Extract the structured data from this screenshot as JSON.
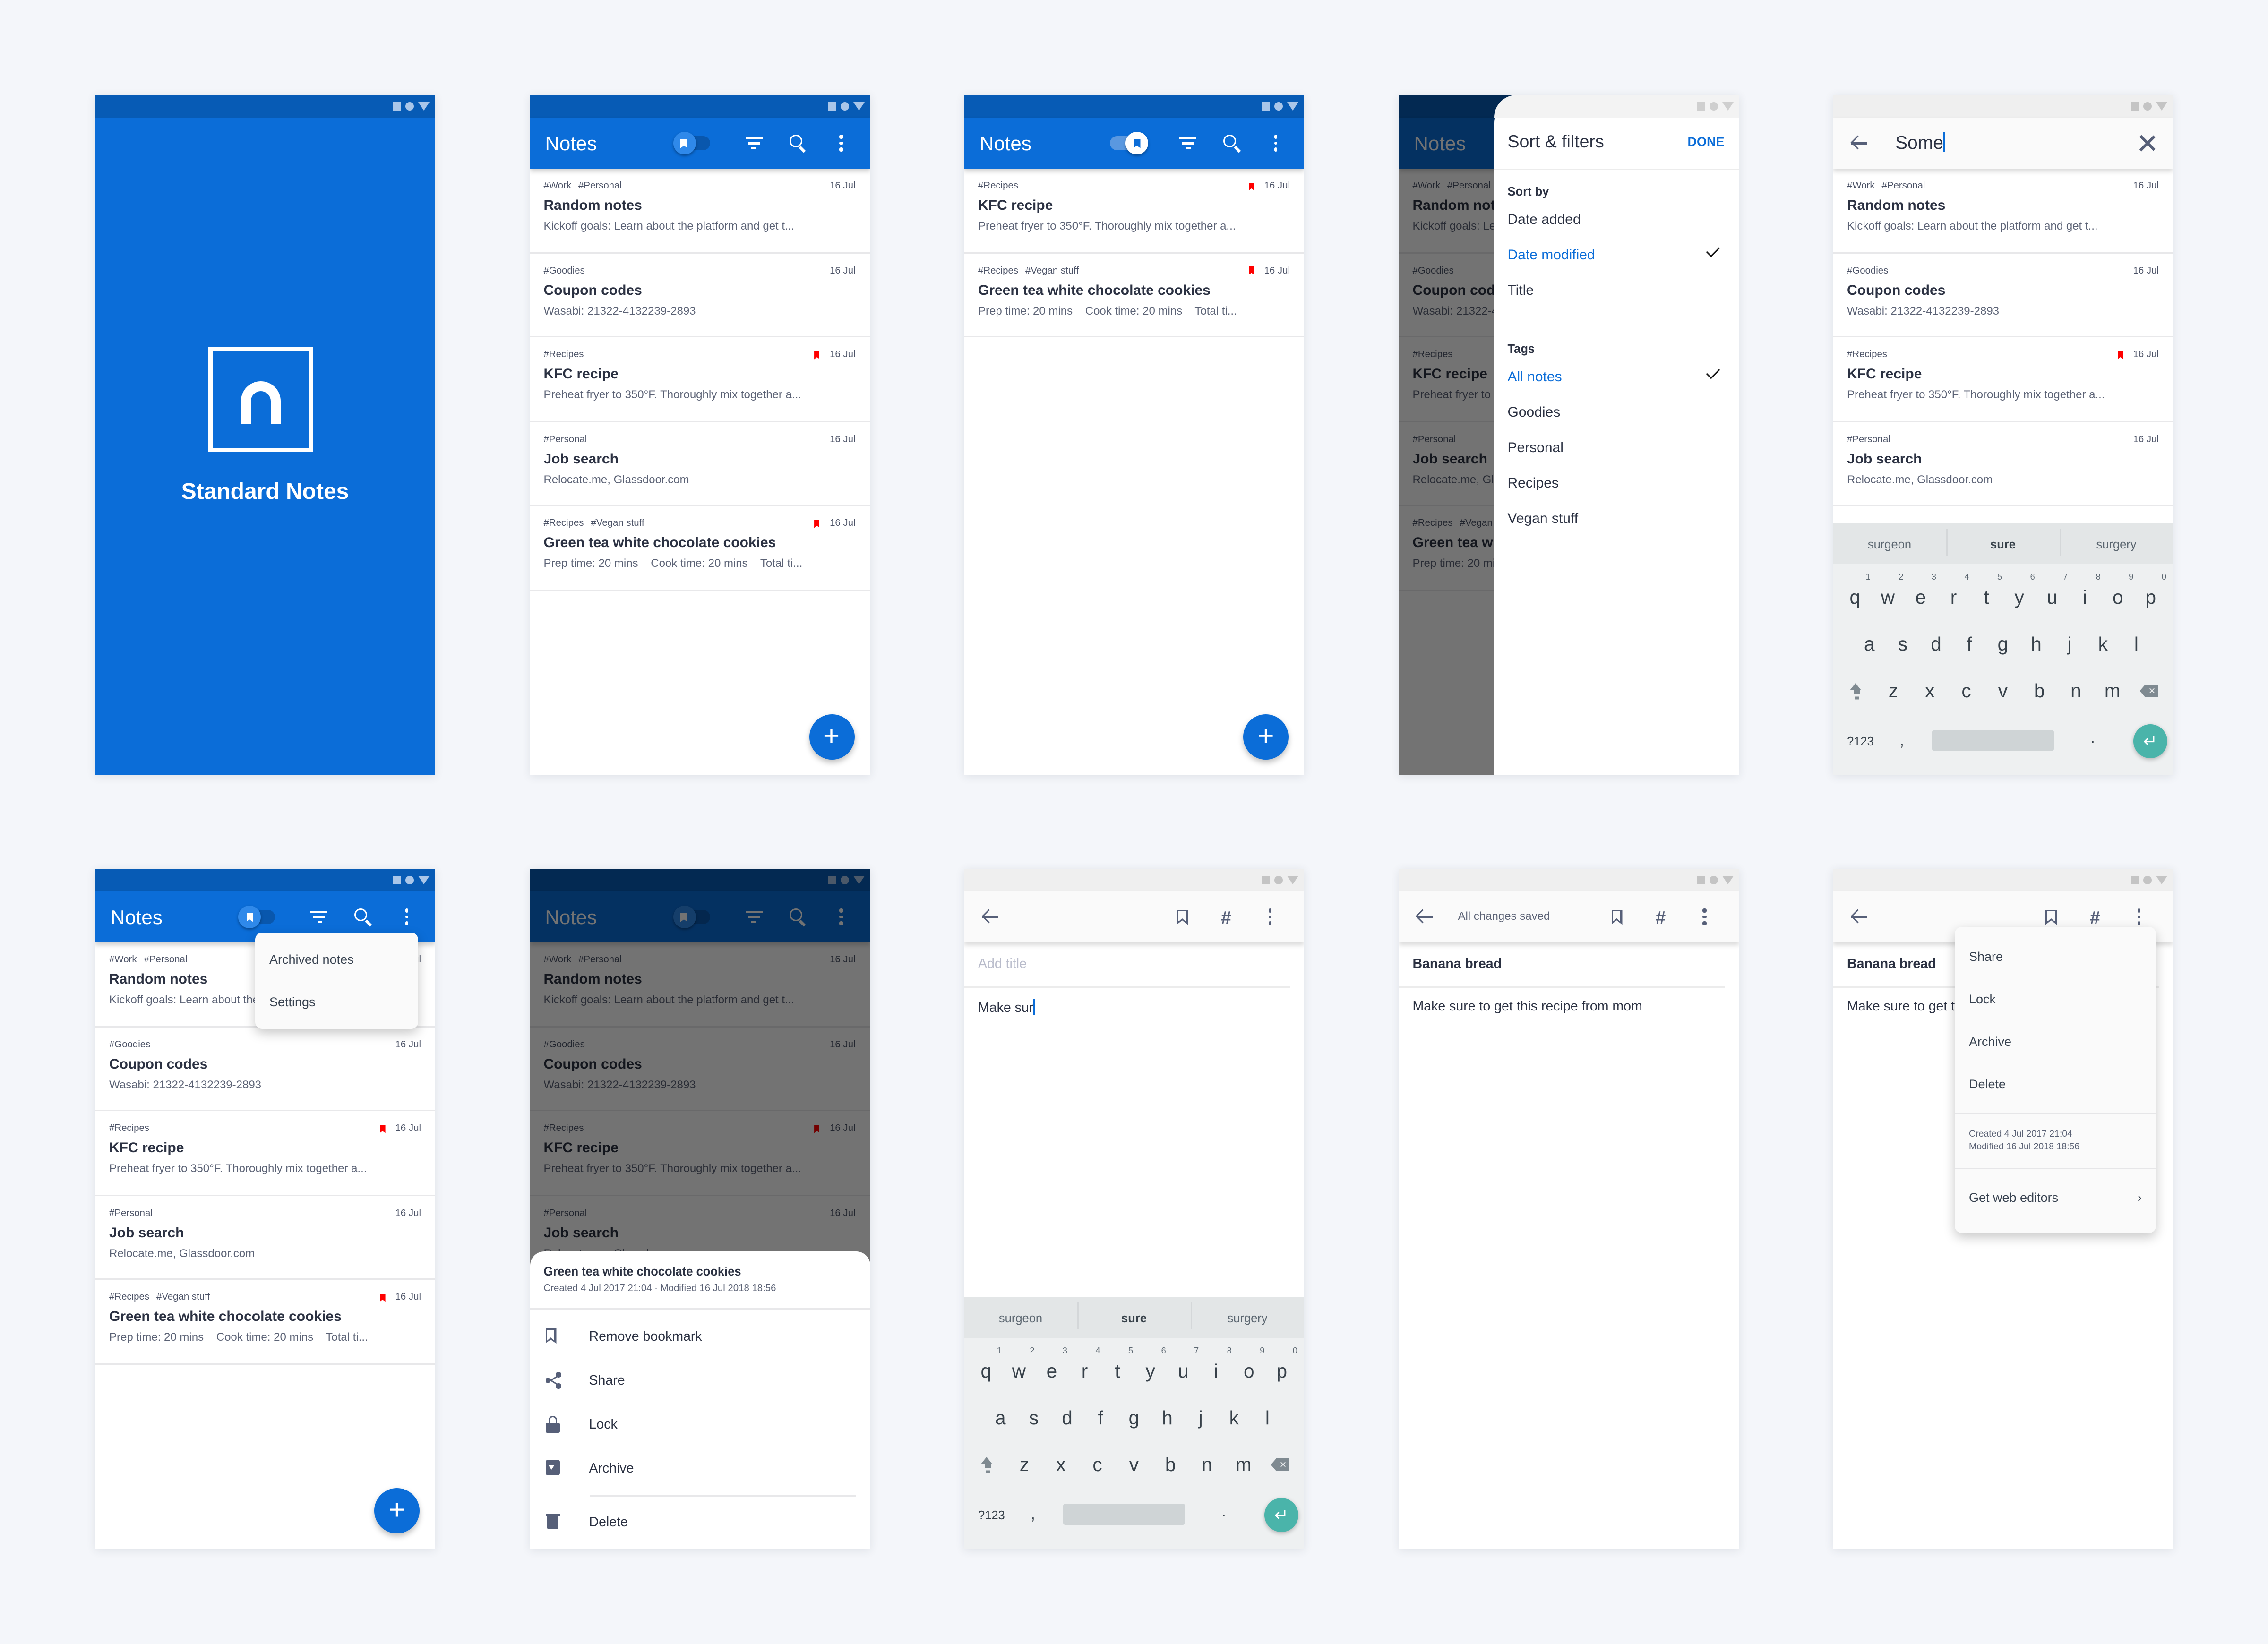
{
  "colors": {
    "brand_blue": "#0b6dd8",
    "status_blue": "#075bb5",
    "bookmark_red": "#ff0000",
    "enter_teal": "#4ab4aa",
    "background": "#f4f6fa"
  },
  "notes": [
    {
      "tags": [
        "#Work",
        "#Personal"
      ],
      "date": "16 Jul",
      "bookmarked": false,
      "title": "Random notes",
      "preview": "Kickoff goals: Learn about the platform and get t..."
    },
    {
      "tags": [
        "#Goodies"
      ],
      "date": "16 Jul",
      "bookmarked": false,
      "title": "Coupon codes",
      "preview": "Wasabi: 21322-4132239-2893"
    },
    {
      "tags": [
        "#Recipes"
      ],
      "date": "16 Jul",
      "bookmarked": true,
      "title": "KFC recipe",
      "preview": "Preheat fryer to 350°F. Thoroughly mix together a..."
    },
    {
      "tags": [
        "#Personal"
      ],
      "date": "16 Jul",
      "bookmarked": false,
      "title": "Job search",
      "preview": "Relocate.me, Glassdoor.com"
    },
    {
      "tags": [
        "#Recipes",
        "#Vegan stuff"
      ],
      "date": "16 Jul",
      "bookmarked": true,
      "title": "Green tea white chocolate cookies",
      "preview": "Prep time: 20 mins    Cook time: 20 mins    Total ti..."
    }
  ],
  "splash": {
    "app_name": "Standard Notes",
    "logo_icon": "standard-notes-logo"
  },
  "list_screen": {
    "title": "Notes",
    "bookmark_filter_on": false,
    "fab_label": "+",
    "icons": [
      "bookmark-toggle",
      "filter-icon",
      "search-icon",
      "more-vert-icon"
    ]
  },
  "bookmarked_screen": {
    "title": "Notes",
    "bookmark_filter_on": true,
    "visible_note_indexes": [
      2,
      4
    ],
    "fab_label": "+"
  },
  "sort_filters": {
    "title": "Sort & filters",
    "done_label": "DONE",
    "sort_by_label": "Sort by",
    "sort_options": [
      {
        "label": "Date added",
        "selected": false
      },
      {
        "label": "Date modified",
        "selected": true
      },
      {
        "label": "Title",
        "selected": false
      }
    ],
    "tags_label": "Tags",
    "tag_options": [
      {
        "label": "All notes",
        "selected": true
      },
      {
        "label": "Goodies",
        "selected": false
      },
      {
        "label": "Personal",
        "selected": false
      },
      {
        "label": "Recipes",
        "selected": false
      },
      {
        "label": "Vegan stuff",
        "selected": false
      }
    ],
    "background_title": "Notes"
  },
  "search_screen": {
    "query": "Some",
    "visible_note_indexes": [
      0,
      1,
      2,
      3
    ]
  },
  "keyboard": {
    "suggestions": [
      "surgeon",
      "sure",
      "surgery"
    ],
    "row1": [
      "q",
      "w",
      "e",
      "r",
      "t",
      "y",
      "u",
      "i",
      "o",
      "p"
    ],
    "row1_numbers": [
      "1",
      "2",
      "3",
      "4",
      "5",
      "6",
      "7",
      "8",
      "9",
      "0"
    ],
    "row2": [
      "a",
      "s",
      "d",
      "f",
      "g",
      "h",
      "j",
      "k",
      "l"
    ],
    "row3": [
      "z",
      "x",
      "c",
      "v",
      "b",
      "n",
      "m"
    ],
    "symbols_label": "?123",
    "comma": ",",
    "period": ".",
    "enter_icon": "↵",
    "backspace_icon": "×"
  },
  "overflow_menu": {
    "items": [
      "Archived notes",
      "Settings"
    ]
  },
  "action_sheet": {
    "note_title": "Green tea white chocolate cookies",
    "meta": "Created 4 Jul 2017 21:04  ·  Modified 16 Jul 2018 18:56",
    "items": [
      {
        "label": "Remove bookmark",
        "icon": "bookmark-outline-icon"
      },
      {
        "label": "Share",
        "icon": "share-icon"
      },
      {
        "label": "Lock",
        "icon": "lock-icon"
      },
      {
        "label": "Archive",
        "icon": "archive-icon"
      },
      {
        "label": "Delete",
        "icon": "delete-icon"
      }
    ]
  },
  "editor_new": {
    "title_placeholder": "Add title",
    "body": "Make sur"
  },
  "editor_saved": {
    "status": "All changes saved",
    "title": "Banana bread",
    "body": "Make sure to get this recipe from mom"
  },
  "editor_menu": {
    "title": "Banana bread",
    "body_partial": "Make sure to get this recipe from mom",
    "items": [
      "Share",
      "Lock",
      "Archive",
      "Delete"
    ],
    "created": "Created 4 Jul 2017 21:04",
    "modified": "Modified 16 Jul 2018 18:56",
    "web_editors_label": "Get web editors",
    "web_editors_chevron": "›"
  }
}
